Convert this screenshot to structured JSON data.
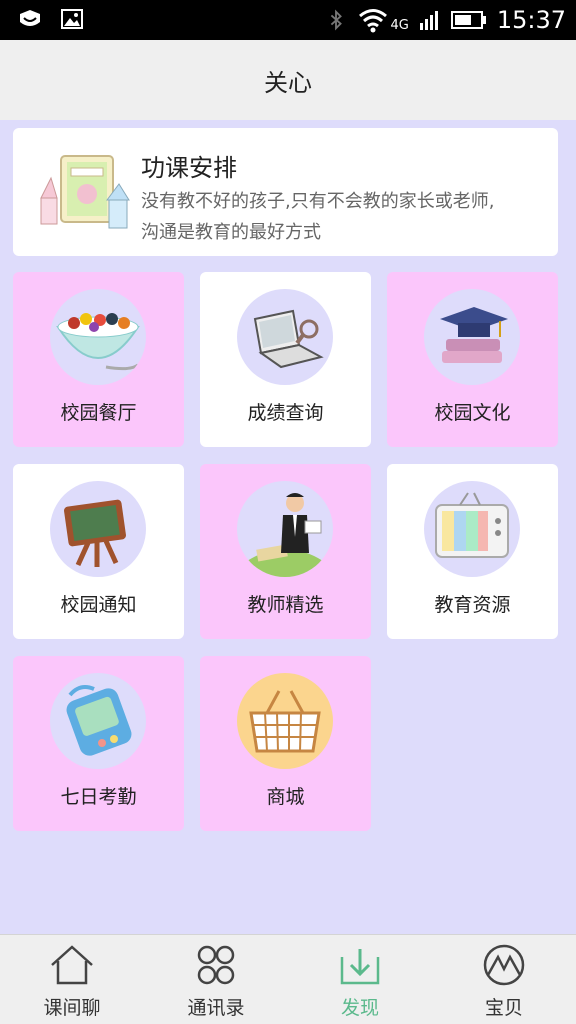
{
  "status_bar": {
    "time": "15:37",
    "network": "4G"
  },
  "header": {
    "title": "关心"
  },
  "banner": {
    "title": "功课安排",
    "line1": "没有教不好的孩子,只有不会教的家长或老师,",
    "line2": "沟通是教育的最好方式"
  },
  "grid": {
    "items": [
      {
        "label": "校园餐厅",
        "icon": "cereal-bowl-icon"
      },
      {
        "label": "成绩查询",
        "icon": "laptop-magnifier-icon"
      },
      {
        "label": "校园文化",
        "icon": "graduation-cap-books-icon"
      },
      {
        "label": "校园通知",
        "icon": "chalkboard-icon"
      },
      {
        "label": "教师精选",
        "icon": "teacher-icon"
      },
      {
        "label": "教育资源",
        "icon": "tv-icon"
      },
      {
        "label": "七日考勤",
        "icon": "handheld-device-icon"
      },
      {
        "label": "商城",
        "icon": "shopping-basket-icon"
      }
    ]
  },
  "tabbar": {
    "tabs": [
      {
        "label": "课间聊",
        "icon": "house-icon"
      },
      {
        "label": "通讯录",
        "icon": "four-circles-icon"
      },
      {
        "label": "发现",
        "icon": "download-tray-icon",
        "active": true
      },
      {
        "label": "宝贝",
        "icon": "mountain-circle-icon"
      }
    ]
  },
  "colors": {
    "background": "#dedcfb",
    "tile_pink": "#fbc6fb",
    "tile_white": "#ffffff",
    "active_tab": "#5bb98c"
  }
}
